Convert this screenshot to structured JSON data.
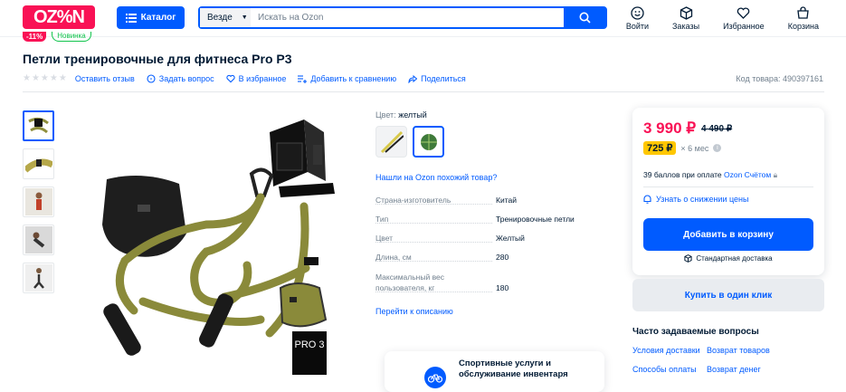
{
  "header": {
    "logo": "OZ%N",
    "catalog_label": "Каталог",
    "search_scope": "Везде",
    "search_placeholder": "Искать на Ozon",
    "links": [
      {
        "label": "Войти",
        "icon": "user-icon"
      },
      {
        "label": "Заказы",
        "icon": "box-icon"
      },
      {
        "label": "Избранное",
        "icon": "heart-icon"
      },
      {
        "label": "Корзина",
        "icon": "cart-icon"
      }
    ]
  },
  "badges": {
    "discount": "-11%",
    "new": "Новинка"
  },
  "product": {
    "title": "Петли тренировочные для фитнеса Pro P3",
    "actions": {
      "review": "Оставить отзыв",
      "question": "Задать вопрос",
      "favorite": "В избранное",
      "compare": "Добавить к сравнению",
      "share": "Поделиться"
    },
    "sku": "Код товара: 490397161",
    "color_label": "Цвет:",
    "color_value": "желтый",
    "similar_link": "Нашли на Ozon похожий товар?",
    "specs": [
      {
        "key": "Страна-изготовитель",
        "value": "Китай"
      },
      {
        "key": "Тип",
        "value": "Тренировочные петли"
      },
      {
        "key": "Цвет",
        "value": "Желтый"
      },
      {
        "key": "Длина, см",
        "value": "280"
      },
      {
        "key": "Максимальный вес пользователя, кг",
        "value": "180"
      }
    ],
    "to_description": "Перейти к описанию",
    "promo": "Спортивные услуги и обслуживание инвентаря",
    "image_badge": "PRO 3"
  },
  "buy": {
    "price": "3 990 ₽",
    "old_price": "4 490 ₽",
    "installment": "725 ₽",
    "installment_term": "× 6 мес",
    "points_prefix": "39 баллов при оплате ",
    "points_link": "Ozon Счётом",
    "notify": "Узнать о снижении цены",
    "add_to_cart": "Добавить в корзину",
    "delivery": "Стандартная доставка",
    "one_click": "Купить в один клик"
  },
  "faq": {
    "title": "Часто задаваемые вопросы",
    "links": [
      "Условия доставки",
      "Возврат товаров",
      "Способы оплаты",
      "Возврат денег"
    ]
  },
  "colors": {
    "accent": "#005bff",
    "brand": "#f91155",
    "strap": "#8f8f3c",
    "installment": "#ffc700"
  }
}
